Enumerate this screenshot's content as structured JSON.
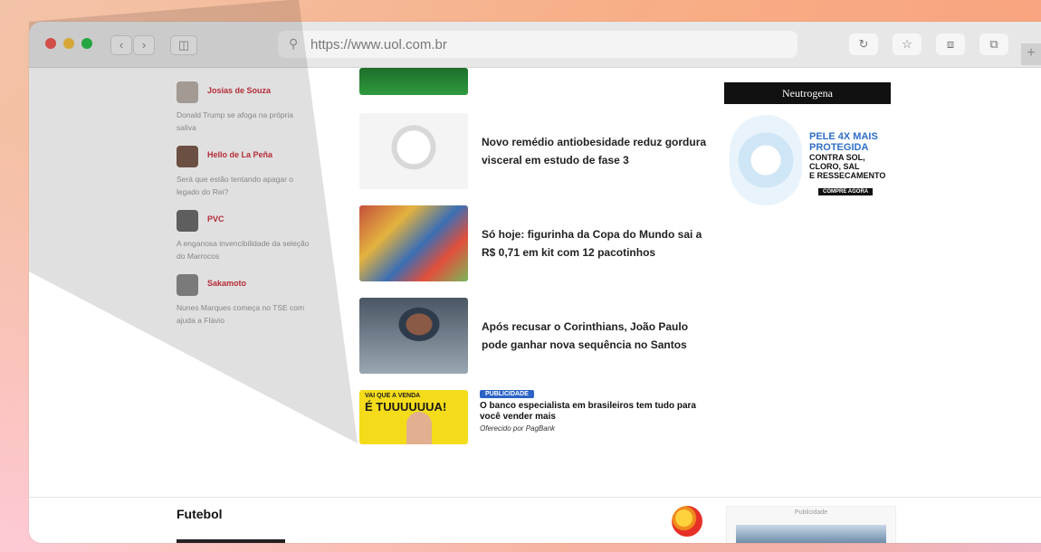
{
  "browser": {
    "url": "https://www.uol.com.br",
    "traffic_lights": {
      "close": "#ee5a52",
      "minimize": "#f5bd40",
      "zoom": "#2bbe4c"
    },
    "icons": [
      "back-icon",
      "forward-icon",
      "sidebar-icon",
      "search-icon",
      "reload-icon",
      "star-icon",
      "share-icon",
      "tabs-icon",
      "plus-icon"
    ]
  },
  "columnists": [
    {
      "name": "Josias de Souza",
      "desc": "Donald Trump se afoga na própria saliva"
    },
    {
      "name": "Hello de La Peña",
      "desc": "Será que estão tentando apagar o legado do Rei?"
    },
    {
      "name": "PVC",
      "desc": "A enganosa invencibilidade da seleção do Marrocos"
    },
    {
      "name": "Sakamoto",
      "desc": "Nunes Marques começa no TSE com ajuda a Flávio"
    }
  ],
  "news": [
    {
      "headline": "Novo remédio antiobesidade reduz gordura visceral em estudo de fase 3"
    },
    {
      "headline": "Só hoje: figurinha da Copa do Mundo sai a R$ 0,71 em kit com 12 pacotinhos"
    },
    {
      "headline": "Após recusar o Corinthians, João Paulo pode ganhar nova sequência no Santos"
    }
  ],
  "sponsored": {
    "badge": "PUBLICIDADE",
    "headline": "O banco especialista em brasileiros tem tudo para você vender mais",
    "byline": "Oferecido por PagBank",
    "image_text_small": "VAI QUE A VENDA",
    "image_text_big": "É TUUUUUUA!"
  },
  "ad_neutrogena": {
    "brand": "Neutrogena",
    "line1": "PELE 4X MAIS",
    "line2": "PROTEGIDA",
    "line3": "CONTRA SOL,",
    "line4": "CLORO, SAL",
    "line5": "E RESSECAMENTO",
    "cta": "COMPRE AGORA"
  },
  "footer": {
    "section_title": "Futebol",
    "ad_label": "Publicidade"
  }
}
